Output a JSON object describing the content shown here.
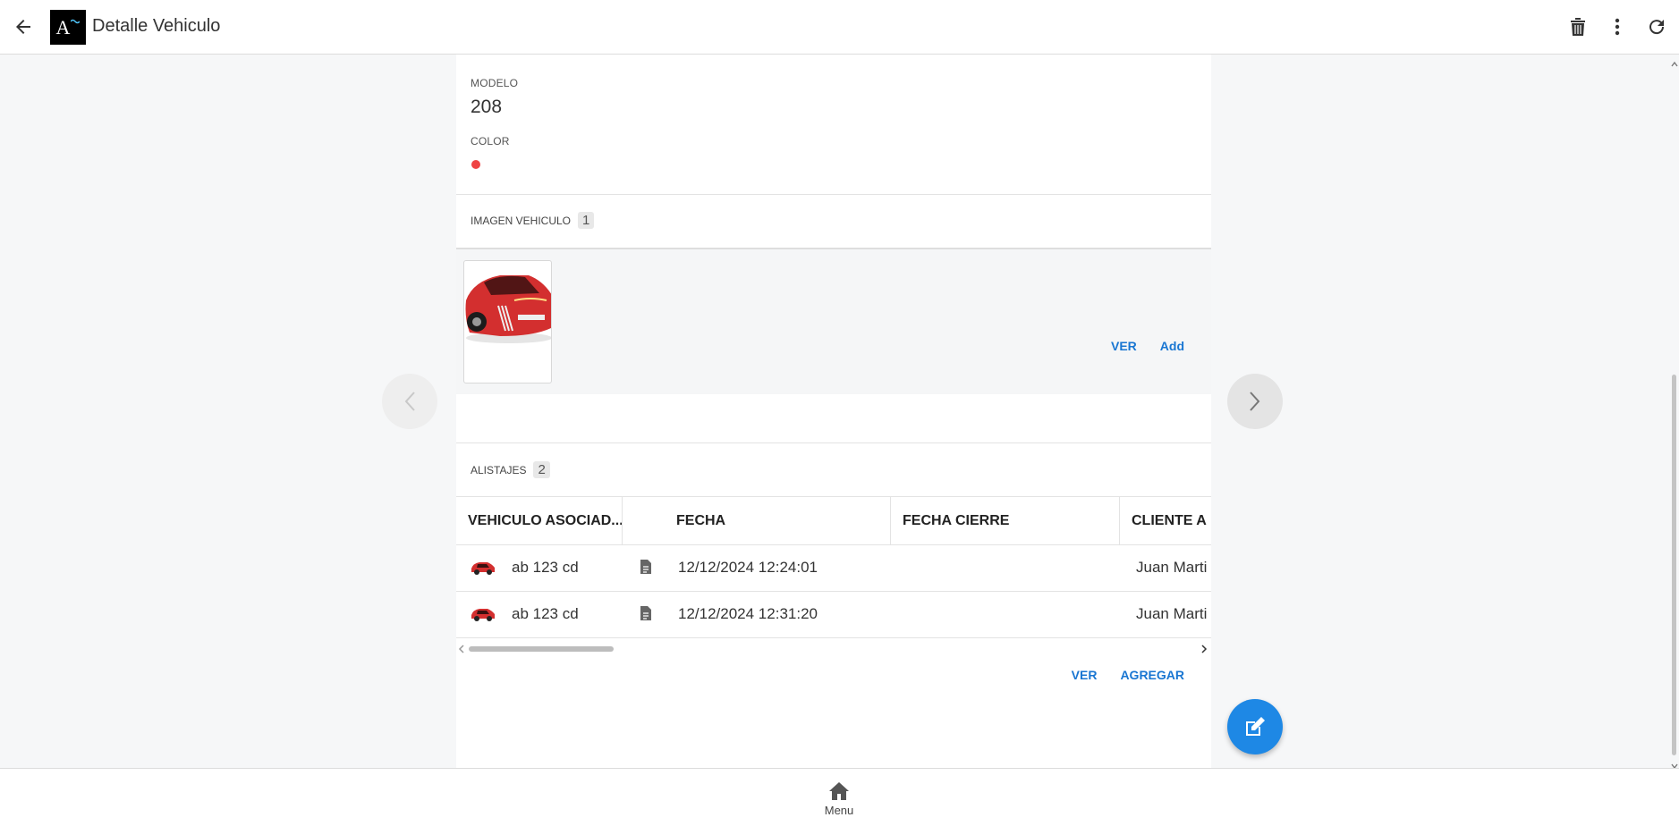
{
  "header": {
    "title": "Detalle Vehiculo",
    "logo_text": "A"
  },
  "details": {
    "modelo_label": "MODELO",
    "modelo_value": "208",
    "color_label": "COLOR",
    "color_value": "#ef4444"
  },
  "imagen_section": {
    "title": "IMAGEN VEHICULO",
    "count": "1",
    "ver_label": "VER",
    "add_label": "Add"
  },
  "alistajes_section": {
    "title": "ALISTAJES",
    "count": "2",
    "columns": [
      "VEHICULO ASOCIAD...",
      "FECHA",
      "FECHA CIERRE",
      "CLIENTE A"
    ],
    "rows": [
      {
        "vehiculo": "ab 123 cd",
        "fecha": "12/12/2024 12:24:01",
        "fecha_cierre": "",
        "cliente": "Juan Marti"
      },
      {
        "vehiculo": "ab 123 cd",
        "fecha": "12/12/2024 12:31:20",
        "fecha_cierre": "",
        "cliente": "Juan Marti"
      }
    ],
    "ver_label": "VER",
    "agregar_label": "AGREGAR"
  },
  "bottom_nav": {
    "menu_label": "Menu"
  },
  "colors": {
    "accent": "#1976d2",
    "fab": "#1e88e5",
    "car_red": "#d32f2f"
  }
}
